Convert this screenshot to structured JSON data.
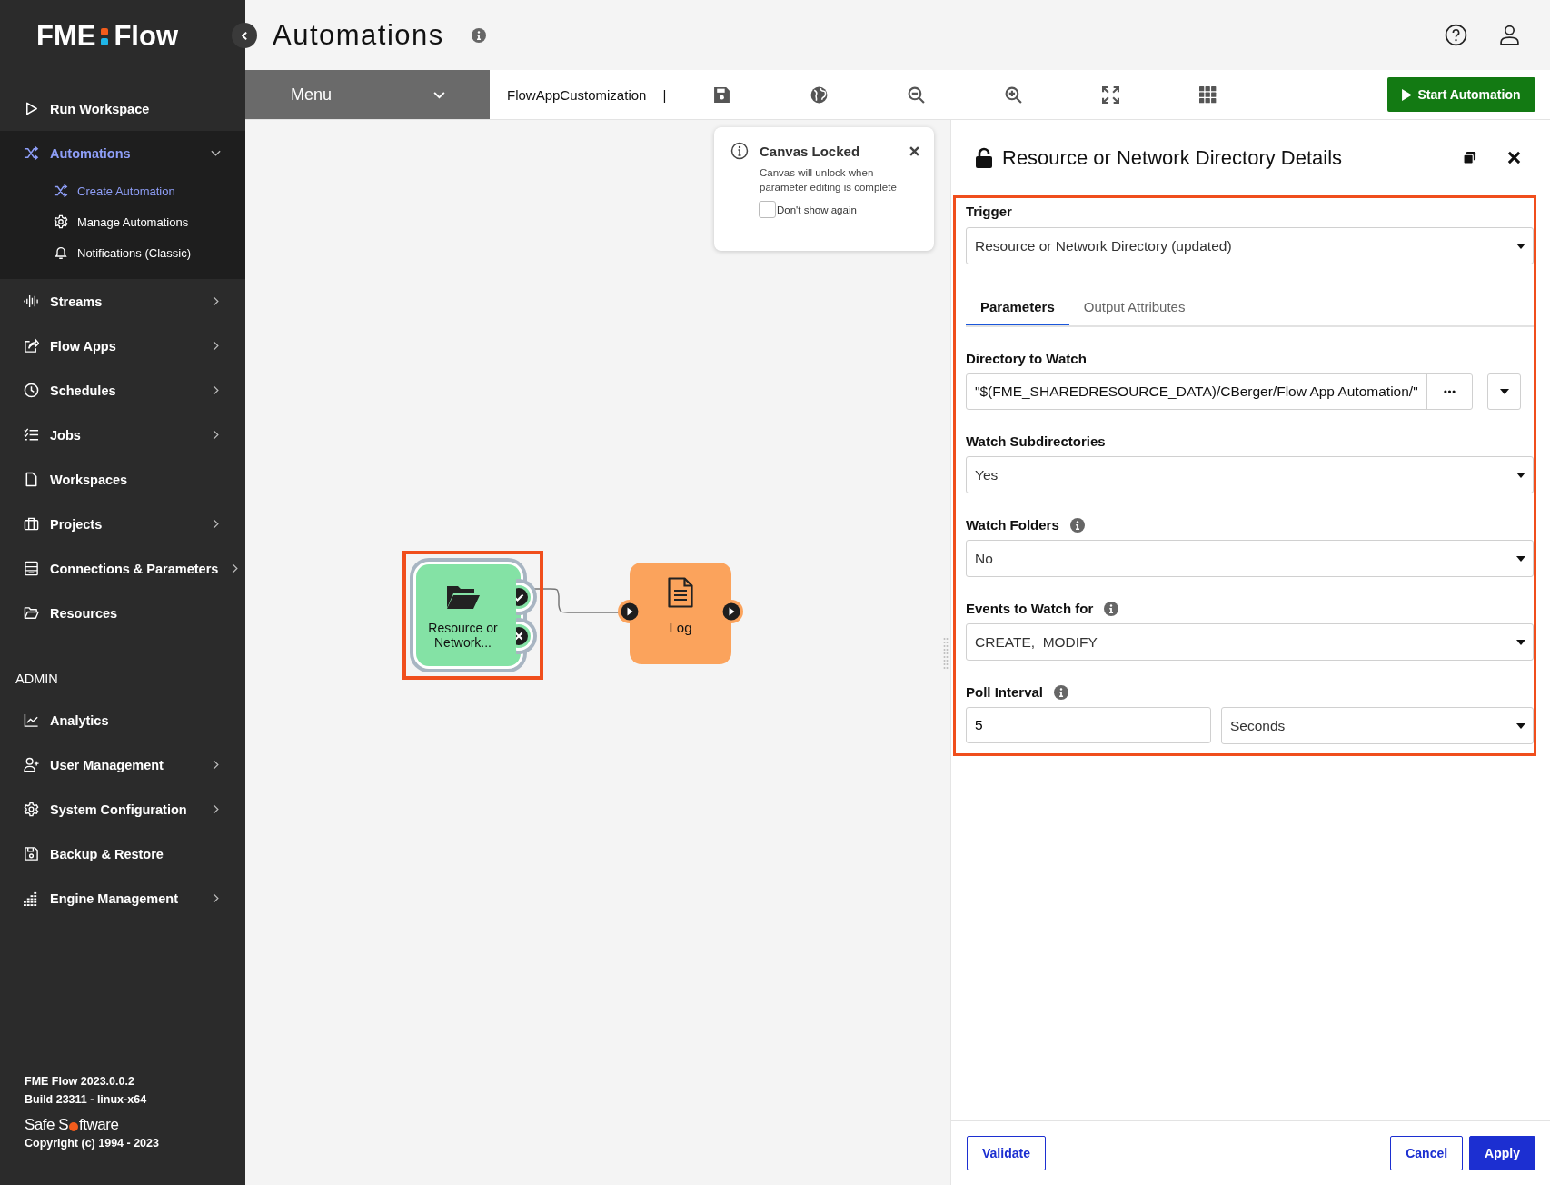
{
  "sidebar": {
    "logo": {
      "left": "FME",
      "right": "Flow"
    },
    "nav": [
      {
        "label": "Run Workspace",
        "selected": false
      },
      {
        "label": "Automations",
        "expanded": true,
        "selected": true,
        "children": [
          {
            "label": "Create Automation",
            "selected": true
          },
          {
            "label": "Manage Automations",
            "selected": false
          },
          {
            "label": "Notifications (Classic)",
            "selected": false
          }
        ]
      },
      {
        "label": "Streams",
        "expanded": false,
        "selected": false
      },
      {
        "label": "Flow Apps",
        "expanded": false,
        "selected": false
      },
      {
        "label": "Schedules",
        "expanded": false,
        "selected": false
      },
      {
        "label": "Jobs",
        "expanded": false,
        "selected": false
      },
      {
        "label": "Workspaces",
        "selected": false
      },
      {
        "label": "Projects",
        "expanded": false,
        "selected": false
      },
      {
        "label": "Connections & Parameters",
        "expanded": false,
        "selected": false
      },
      {
        "label": "Resources",
        "selected": false
      }
    ],
    "admin": {
      "heading": "ADMIN",
      "items": [
        {
          "label": "Analytics",
          "selected": false
        },
        {
          "label": "User Management",
          "expanded": false,
          "selected": false
        },
        {
          "label": "System Configuration",
          "expanded": false,
          "selected": false
        },
        {
          "label": "Backup & Restore",
          "selected": false
        },
        {
          "label": "Engine Management",
          "expanded": false,
          "selected": false
        }
      ]
    },
    "footer": {
      "version": "FME Flow 2023.0.0.2",
      "build": "Build 23311 - linux-x64",
      "company": {
        "before": "Safe S",
        "after": "ftware"
      },
      "copyright": "Copyright (c) 1994 - 2023"
    }
  },
  "header": {
    "title": "Automations"
  },
  "toolbar": {
    "menu": "Menu",
    "workspace": "FlowAppCustomization",
    "separator": "|",
    "start_button": "Start Automation"
  },
  "canvas": {
    "popup": {
      "title": "Canvas Locked",
      "message": "Canvas will unlock when parameter editing is complete",
      "checkbox": {
        "label": "Don't show again",
        "checked": false
      }
    },
    "nodes": [
      {
        "kind": "trigger",
        "label": "Resource or Network...",
        "highlighted": true
      },
      {
        "kind": "action",
        "label": "Log"
      }
    ]
  },
  "panel": {
    "title": "Resource or Network Directory Details",
    "locked": false,
    "highlighted": true,
    "trigger": {
      "label": "Trigger",
      "value": "Resource or Network Directory (updated)"
    },
    "tabs": [
      {
        "label": "Parameters",
        "selected": true
      },
      {
        "label": "Output Attributes",
        "selected": false
      }
    ],
    "fields": [
      {
        "kind": "path",
        "label": "Directory to Watch",
        "value": "\"$(FME_SHAREDRESOURCE_DATA)/CBerger/Flow App Automation/\""
      },
      {
        "kind": "select",
        "label": "Watch Subdirectories",
        "value": "Yes"
      },
      {
        "kind": "select",
        "label": "Watch Folders",
        "value": "No",
        "info": true
      },
      {
        "kind": "select",
        "label": "Events to Watch for",
        "value": "CREATE,  MODIFY",
        "info": true
      },
      {
        "kind": "interval",
        "label": "Poll Interval",
        "value": "5",
        "unit": "Seconds",
        "info": true
      }
    ],
    "buttons": {
      "validate": "Validate",
      "cancel": "Cancel",
      "apply": "Apply"
    }
  }
}
